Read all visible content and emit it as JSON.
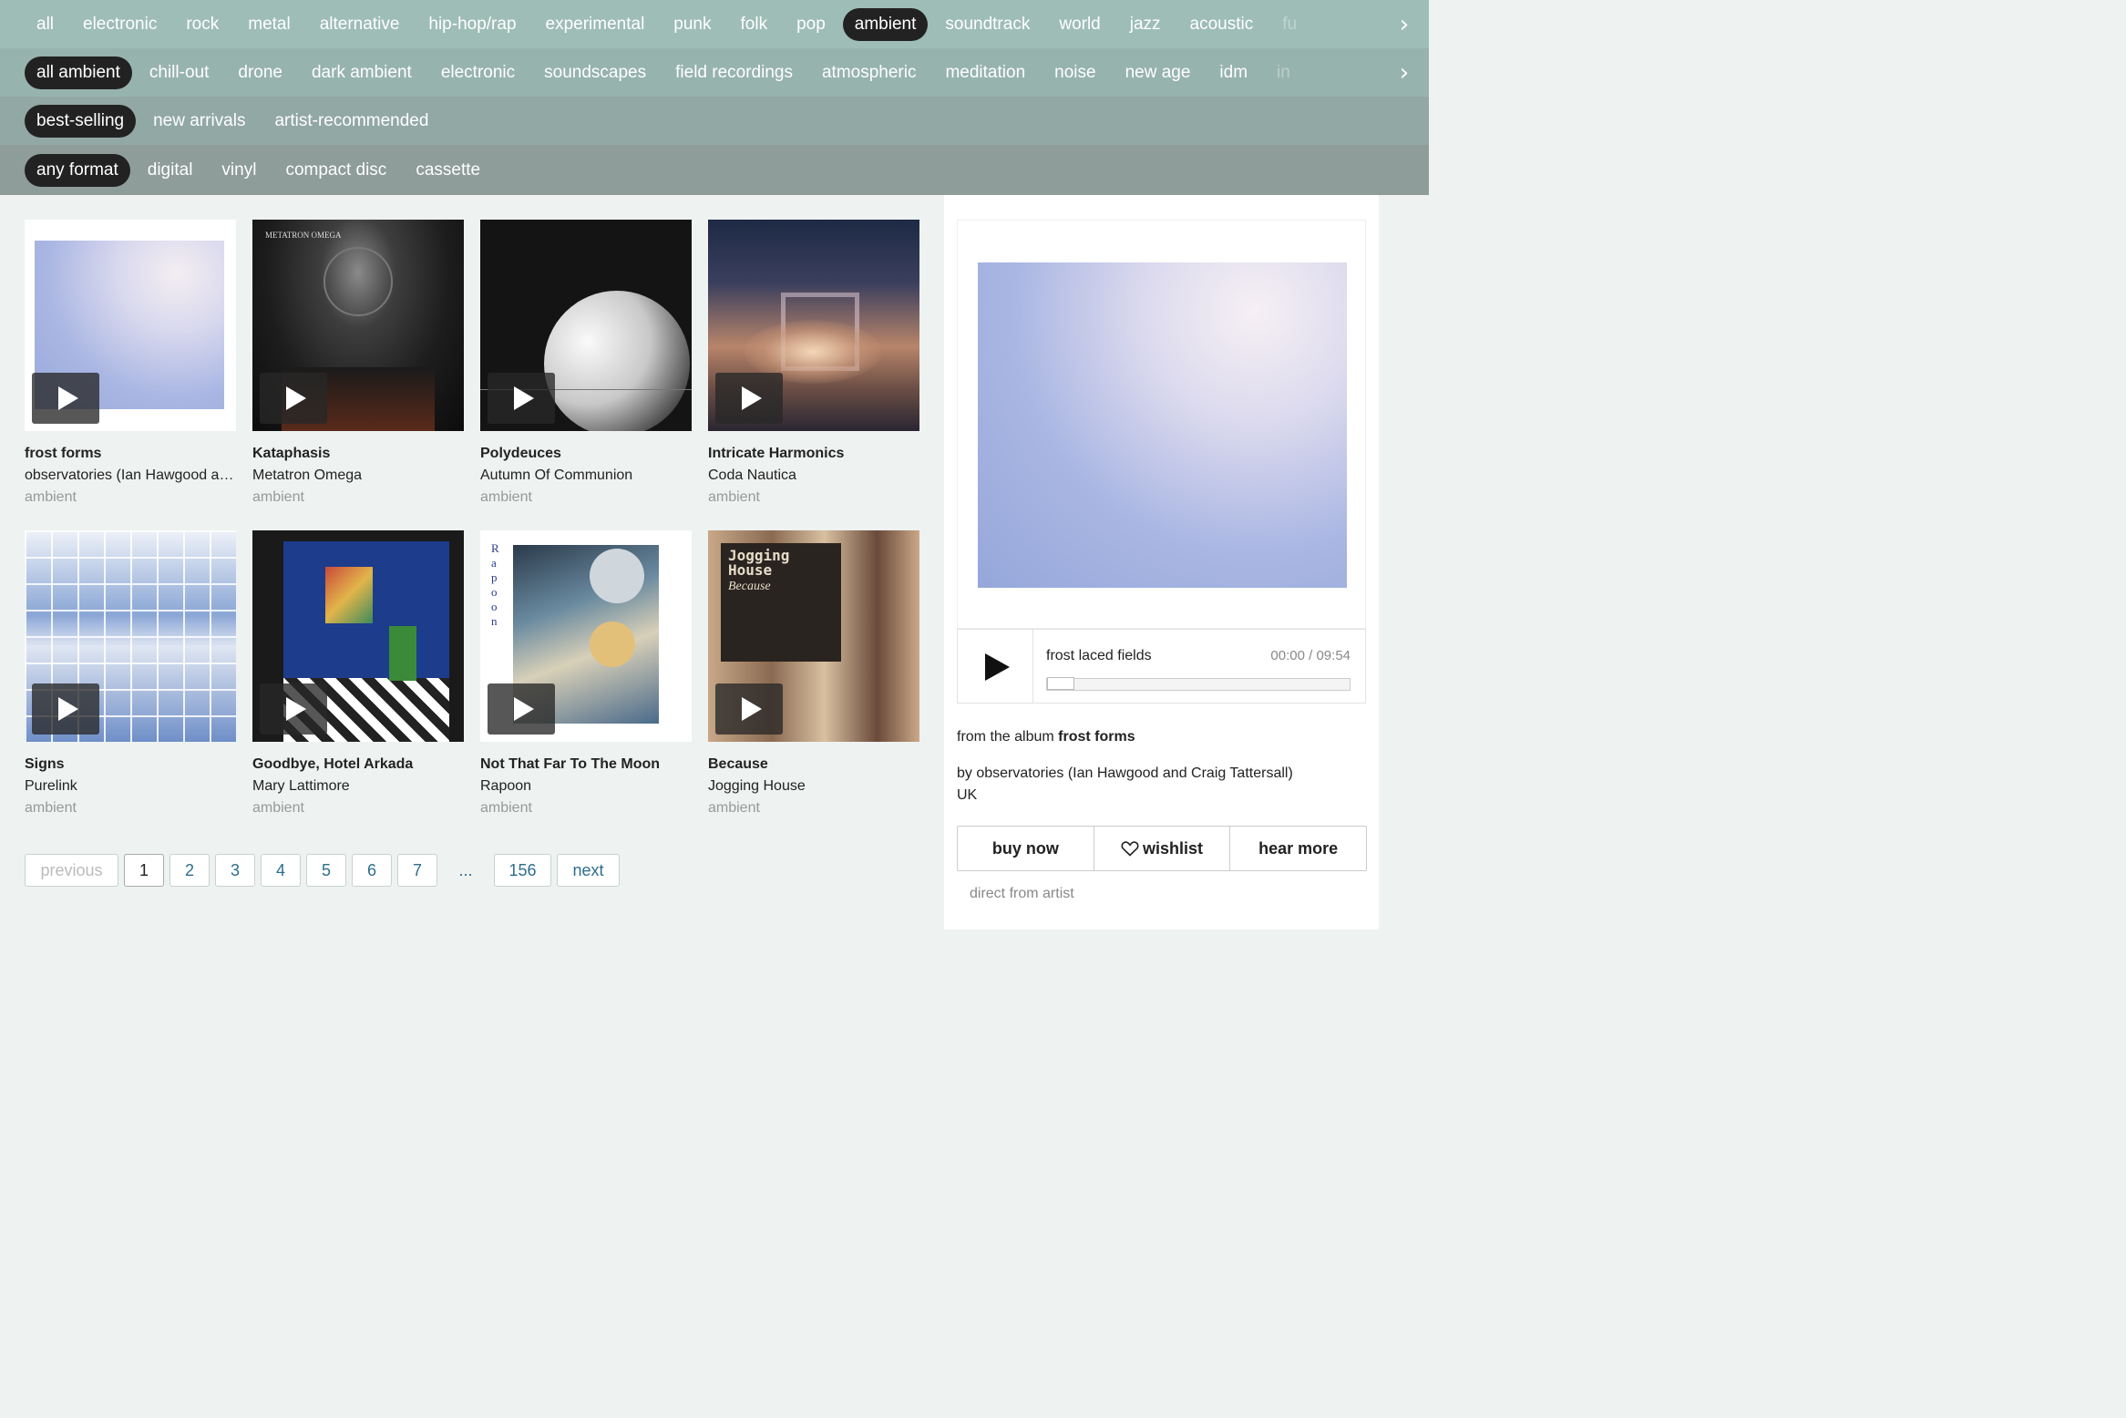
{
  "genres": {
    "items": [
      "all",
      "electronic",
      "rock",
      "metal",
      "alternative",
      "hip-hop/rap",
      "experimental",
      "punk",
      "folk",
      "pop",
      "ambient",
      "soundtrack",
      "world",
      "jazz",
      "acoustic",
      "fu"
    ],
    "active": "ambient"
  },
  "subgenres": {
    "items": [
      "all ambient",
      "chill-out",
      "drone",
      "dark ambient",
      "electronic",
      "soundscapes",
      "field recordings",
      "atmospheric",
      "meditation",
      "noise",
      "new age",
      "idm",
      "in"
    ],
    "active": "all ambient"
  },
  "sort": {
    "items": [
      "best-selling",
      "new arrivals",
      "artist-recommended"
    ],
    "active": "best-selling"
  },
  "format": {
    "items": [
      "any format",
      "digital",
      "vinyl",
      "compact disc",
      "cassette"
    ],
    "active": "any format"
  },
  "albums": [
    {
      "title": "frost forms",
      "artist": "observatories (Ian Hawgood a…",
      "genre": "ambient"
    },
    {
      "title": "Kataphasis",
      "artist": "Metatron Omega",
      "genre": "ambient",
      "cover_text": "METATRON OMEGA"
    },
    {
      "title": "Polydeuces",
      "artist": "Autumn Of Communion",
      "genre": "ambient"
    },
    {
      "title": "Intricate Harmonics",
      "artist": "Coda Nautica",
      "genre": "ambient"
    },
    {
      "title": "Signs",
      "artist": "Purelink",
      "genre": "ambient"
    },
    {
      "title": "Goodbye, Hotel Arkada",
      "artist": "Mary Lattimore",
      "genre": "ambient"
    },
    {
      "title": "Not That Far To The Moon",
      "artist": "Rapoon",
      "genre": "ambient",
      "cover_text": "Rapoon"
    },
    {
      "title": "Because",
      "artist": "Jogging House",
      "genre": "ambient",
      "cover_text": "Jogging House",
      "cover_subtext": "Because"
    }
  ],
  "pagination": {
    "previous": "previous",
    "pages": [
      "1",
      "2",
      "3",
      "4",
      "5",
      "6",
      "7"
    ],
    "current": "1",
    "ellipsis": "...",
    "last": "156",
    "next": "next"
  },
  "player": {
    "track": "frost laced fields",
    "time": "00:00 / 09:54",
    "progress": 0,
    "from_label": "from the album",
    "album": "frost forms",
    "by_line": "by observatories (Ian Hawgood and Craig Tattersall)",
    "location": "UK",
    "buy_label": "buy now",
    "wishlist_label": "wishlist",
    "hear_more_label": "hear more",
    "direct": "direct from artist"
  },
  "colors": {
    "bar1": "#9ebdb6",
    "bar2": "#97b3ae",
    "bar3": "#92a8a5",
    "bar4": "#8e9c9a",
    "link": "#2c6e8e"
  }
}
